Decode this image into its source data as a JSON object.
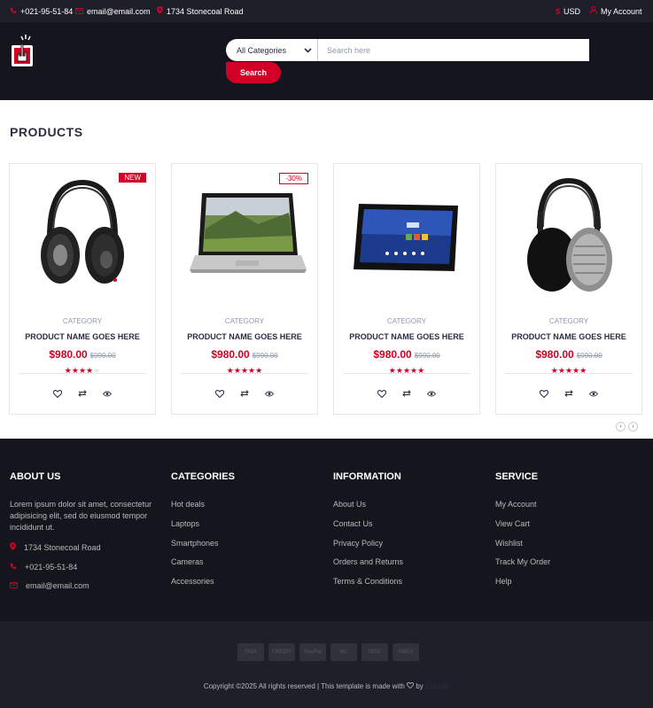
{
  "topbar": {
    "phone": "+021-95-51-84",
    "email": "email@email.com",
    "address": "1734 Stonecoal Road",
    "currency": "USD",
    "account": "My Account"
  },
  "search": {
    "category_selected": "All Categories",
    "placeholder": "Search here",
    "button": "Search"
  },
  "section_title": "PRODUCTS",
  "products": [
    {
      "category": "CATEGORY",
      "name": "PRODUCT NAME GOES HERE",
      "price": "$980.00",
      "old_price": "$990.00",
      "rating": 4,
      "badge": "NEW",
      "image": "headphones-black"
    },
    {
      "category": "CATEGORY",
      "name": "PRODUCT NAME GOES HERE",
      "price": "$980.00",
      "old_price": "$990.00",
      "rating": 5,
      "badge": "-30%",
      "image": "laptop"
    },
    {
      "category": "CATEGORY",
      "name": "PRODUCT NAME GOES HERE",
      "price": "$980.00",
      "old_price": "$990.00",
      "rating": 5,
      "badge": "",
      "image": "tablet"
    },
    {
      "category": "CATEGORY",
      "name": "PRODUCT NAME GOES HERE",
      "price": "$980.00",
      "old_price": "$990.00",
      "rating": 5,
      "badge": "",
      "image": "headphones-silver"
    }
  ],
  "footer": {
    "about": {
      "title": "ABOUT US",
      "text": "Lorem ipsum dolor sit amet, consectetur adipisicing elit, sed do eiusmod tempor incididunt ut.",
      "address": "1734 Stonecoal Road",
      "phone": "+021-95-51-84",
      "email": "email@email.com"
    },
    "categories": {
      "title": "CATEGORIES",
      "links": [
        "Hot deals",
        "Laptops",
        "Smartphones",
        "Cameras",
        "Accessories"
      ]
    },
    "information": {
      "title": "INFORMATION",
      "links": [
        "About Us",
        "Contact Us",
        "Privacy Policy",
        "Orders and Returns",
        "Terms & Conditions"
      ]
    },
    "service": {
      "title": "SERVICE",
      "links": [
        "My Account",
        "View Cart",
        "Wishlist",
        "Track My Order",
        "Help"
      ]
    }
  },
  "payments": [
    "VISA",
    "CREDIT",
    "PayPal",
    "MC",
    "DISC",
    "AMEX"
  ],
  "copyright": "Copyright ©2025 All rights reserved | This template is made with",
  "copyright_by": "by",
  "copyright_brand": "Colorlib",
  "colors": {
    "accent": "#d10024",
    "dark": "#15161d",
    "darker": "#1e1f29"
  }
}
